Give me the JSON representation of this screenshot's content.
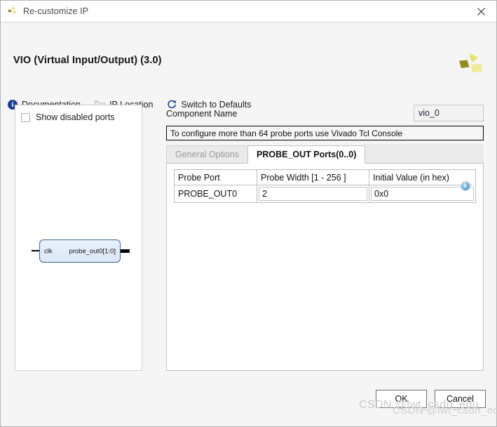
{
  "window": {
    "title": "Re-customize IP",
    "app_icon": "xilinx-logo-icon",
    "close_icon": "close-icon"
  },
  "header": {
    "ip_title": "VIO (Virtual Input/Output) (3.0)",
    "brand_logo": "xilinx-logo-icon",
    "toolbar": [
      {
        "label": "Documentation",
        "icon": "info-circle-icon",
        "enabled": true
      },
      {
        "label": "IP Location",
        "icon": "folder-icon",
        "enabled": false
      },
      {
        "label": "Switch to Defaults",
        "icon": "refresh-icon",
        "enabled": true
      }
    ]
  },
  "left_panel": {
    "show_disabled_ports": {
      "label": "Show disabled ports",
      "checked": false
    },
    "symbol": {
      "input_pin": "clk",
      "output_pin": "probe_out0[1:0]"
    }
  },
  "right_panel": {
    "component_name_label": "Component Name",
    "component_name_value": "vio_0",
    "component_name_placeholder": "Component Name",
    "info_banner": "To configure more than 64 probe ports use Vivado Tcl Console",
    "tabs": [
      {
        "label": "General Options",
        "active": false
      },
      {
        "label": "PROBE_OUT Ports(0..0)",
        "active": true
      }
    ],
    "probe_table": {
      "columns": [
        "Probe Port",
        "Probe Width [1 - 256 ]",
        "Initial Value (in hex)"
      ],
      "rows": [
        {
          "probe_port": "PROBE_OUT0",
          "probe_width": "2",
          "probe_width_icon": "clear-circle-icon",
          "initial_value": "0x0",
          "initial_value_icon": "info-circle-icon"
        }
      ]
    }
  },
  "footer": {
    "ok_label": "OK",
    "cancel_label": "Cancel"
  },
  "watermarks": {
    "primary": "CSDN @lwt_csdn_edu",
    "secondary": "CSDN @lwt_csdn_edu"
  },
  "colors": {
    "accent_blue": "#1b3f94",
    "brand_yellow": "#c9c732",
    "window_bg": "#f5f5f5",
    "panel_bg": "#ffffff",
    "symbol_border": "#3f6296",
    "symbol_fill": "#e3ecf9"
  }
}
